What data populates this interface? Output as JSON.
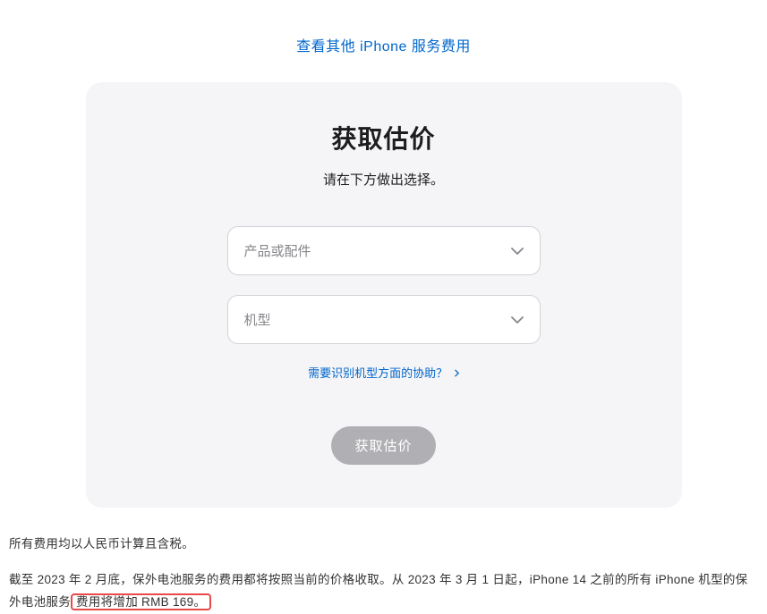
{
  "topLink": {
    "label": "查看其他 iPhone 服务费用"
  },
  "card": {
    "title": "获取估价",
    "subtitle": "请在下方做出选择。",
    "selects": {
      "product": {
        "placeholder": "产品或配件"
      },
      "model": {
        "placeholder": "机型"
      }
    },
    "helpLink": {
      "label": "需要识别机型方面的协助？"
    },
    "submitButton": {
      "label": "获取估价"
    }
  },
  "footer": {
    "line1": "所有费用均以人民币计算且含税。",
    "line2_part1": "截至 2023 年 2 月底，保外电池服务的费用都将按照当前的价格收取。从 2023 年 3 月 1 日起，iPhone 14 之前的所有 iPhone 机型的保外电池服务",
    "line2_highlighted": "费用将增加 RMB 169。"
  }
}
